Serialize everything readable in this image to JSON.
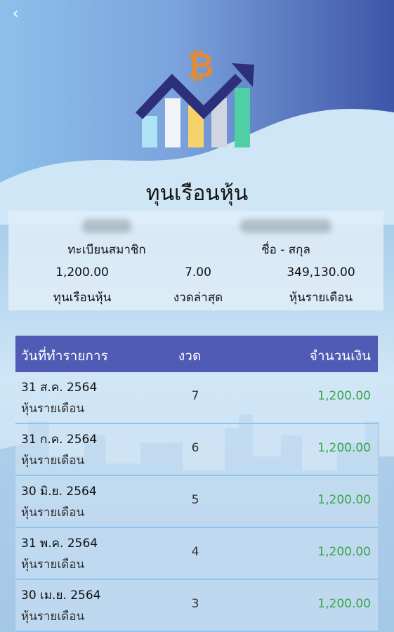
{
  "header": {
    "back_icon": "chevron-left-icon",
    "title": "ทุนเรือนหุ้น"
  },
  "colors": {
    "accent": "#4f5bb4",
    "amount_green": "#3aa54a"
  },
  "member": {
    "member_id_label": "ทะเบียนสมาชิก",
    "name_label": "ชื่อ - สกุล"
  },
  "stats": [
    {
      "value": "1,200.00",
      "label": "ทุนเรือนหุ้น"
    },
    {
      "value": "7.00",
      "label": "งวดล่าสุด"
    },
    {
      "value": "349,130.00",
      "label": "หุ้นรายเดือน"
    }
  ],
  "table": {
    "headers": {
      "date": "วันที่ทำรายการ",
      "installment": "งวด",
      "amount": "จำนวนเงิน"
    },
    "rows": [
      {
        "date": "31 ส.ค. 2564",
        "type": "หุ้นรายเดือน",
        "installment": "7",
        "amount": "1,200.00"
      },
      {
        "date": "31 ก.ค. 2564",
        "type": "หุ้นรายเดือน",
        "installment": "6",
        "amount": "1,200.00"
      },
      {
        "date": "30 มิ.ย. 2564",
        "type": "หุ้นรายเดือน",
        "installment": "5",
        "amount": "1,200.00"
      },
      {
        "date": "31 พ.ค. 2564",
        "type": "หุ้นรายเดือน",
        "installment": "4",
        "amount": "1,200.00"
      },
      {
        "date": "30 เม.ย. 2564",
        "type": "หุ้นรายเดือน",
        "installment": "3",
        "amount": "1,200.00"
      }
    ]
  }
}
